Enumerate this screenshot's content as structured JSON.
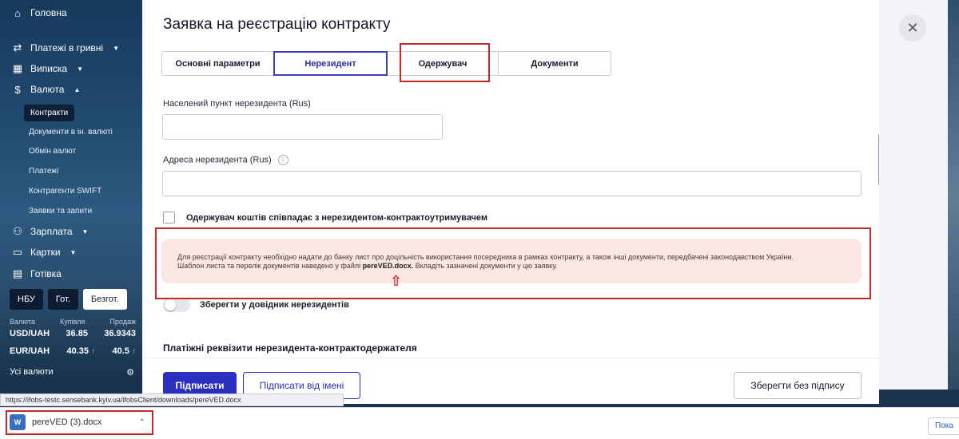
{
  "sidebar": {
    "home": "Головна",
    "payments_uah": "Платежі в гривні",
    "statement": "Виписка",
    "currency": "Валюта",
    "currency_sub": [
      "Контракти",
      "Документи в ін. валюті",
      "Обмін валют",
      "Платежі",
      "Контрагенти SWIFT",
      "Заявки та запити"
    ],
    "salary": "Зарплата",
    "cards": "Картки",
    "cash": "Готівка",
    "rate_tabs": [
      "НБУ",
      "Гот.",
      "Безгот."
    ],
    "rate_head": [
      "Валюта",
      "Купівля",
      "Продаж"
    ],
    "rates": [
      {
        "pair": "USD/UAH",
        "buy": "36.85",
        "sell": "36.9343"
      },
      {
        "pair": "EUR/UAH",
        "buy": "40.35",
        "sell": "40.5"
      }
    ],
    "all_currencies": "Усі валюти"
  },
  "main": {
    "title": "Заявка на реєстрацію контракту",
    "tabs": [
      "Основні параметри",
      "Нерезидент",
      "Одержувач",
      "Документи"
    ],
    "field_city_label": "Населений пункт нерезидента (Rus)",
    "field_address_label": "Адреса нерезидента (Rus)",
    "checkbox_label": "Одержувач коштів співпадає з нерезидентом-контрактоутримувачем",
    "alert_line1": "Для реєстрації контракту необхідно надати до банку лист про доцільність використання посередника в рамках контракту, а також інші документи, передбачені законодавством України.",
    "alert_line2_pre": "Шаблон листа та перелік документів наведено у файлі ",
    "alert_file": "pereVED.docx.",
    "alert_line2_post": " Вкладіть зазначені документи у цю заявку.",
    "toggle_label": "Зберегти у довідник нерезидентів",
    "section_title": "Платіжні реквізити нерезидента-контрактодержателя"
  },
  "footer": {
    "sign": "Підписати",
    "sign_on_behalf": "Підписати від імені",
    "save_unsigned": "Зберегти без підпису"
  },
  "status_url": "https://ifobs-testc.sensebank.kyiv.ua/ifobsClient/downloads/pereVED.docx",
  "download": {
    "file": "pereVED (3).docx",
    "show_all": "Пока"
  },
  "colors": {
    "primary": "#2a2fc0",
    "alert_bg": "#fbe6e2",
    "annotation": "#c62828"
  }
}
